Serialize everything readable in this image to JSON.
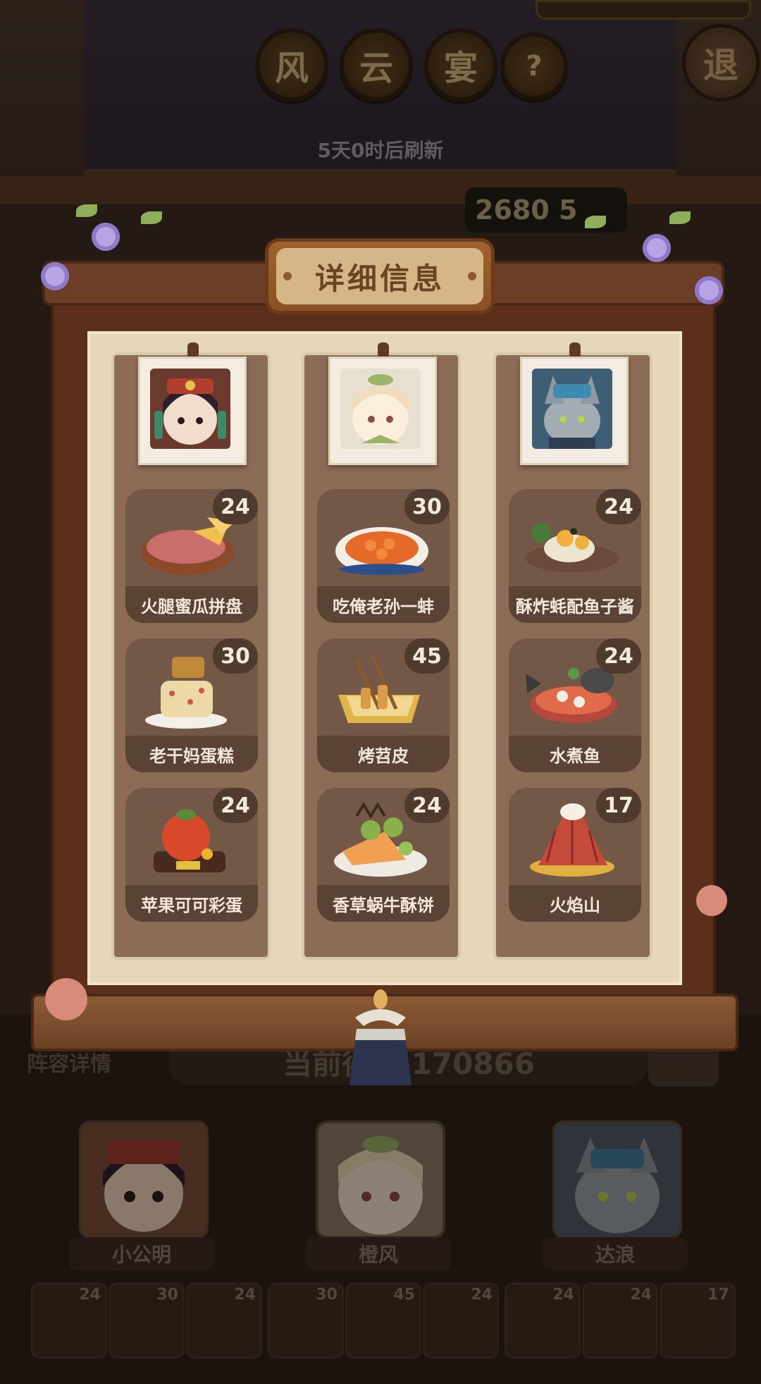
{
  "header": {
    "title_chars": [
      "风",
      "云",
      "宴"
    ],
    "help_label": "?",
    "exit_label": "退",
    "refresh_text": "5天0时后刷新",
    "score_pill": "2680 5"
  },
  "modal": {
    "title": "详细信息",
    "columns": [
      {
        "portrait": "xiaogongming-portrait",
        "dishes": [
          {
            "name": "火腿蜜瓜拼盘",
            "score": "24"
          },
          {
            "name": "老干妈蛋糕",
            "score": "30"
          },
          {
            "name": "苹果可可彩蛋",
            "score": "24"
          }
        ]
      },
      {
        "portrait": "chengfeng-portrait",
        "dishes": [
          {
            "name": "吃俺老孙一蚌",
            "score": "30"
          },
          {
            "name": "烤苕皮",
            "score": "45"
          },
          {
            "name": "香草蜗牛酥饼",
            "score": "24"
          }
        ]
      },
      {
        "portrait": "dalang-portrait",
        "dishes": [
          {
            "name": "酥炸蚝配鱼子酱",
            "score": "24"
          },
          {
            "name": "水煮鱼",
            "score": "24"
          },
          {
            "name": "火焰山",
            "score": "17"
          }
        ]
      }
    ]
  },
  "background": {
    "lineup_link": "阵容详情",
    "current_score": "当前得分 170866",
    "heroes": [
      "小公明",
      "橙风",
      "达浪"
    ],
    "dish_slots": [
      "24",
      "30",
      "24",
      "30",
      "45",
      "24",
      "24",
      "24",
      "17"
    ]
  },
  "colors": {
    "frame": "#5c2f1d",
    "paper": "#e6d7bb",
    "card": "#735847",
    "plaque": "#d6b587"
  }
}
